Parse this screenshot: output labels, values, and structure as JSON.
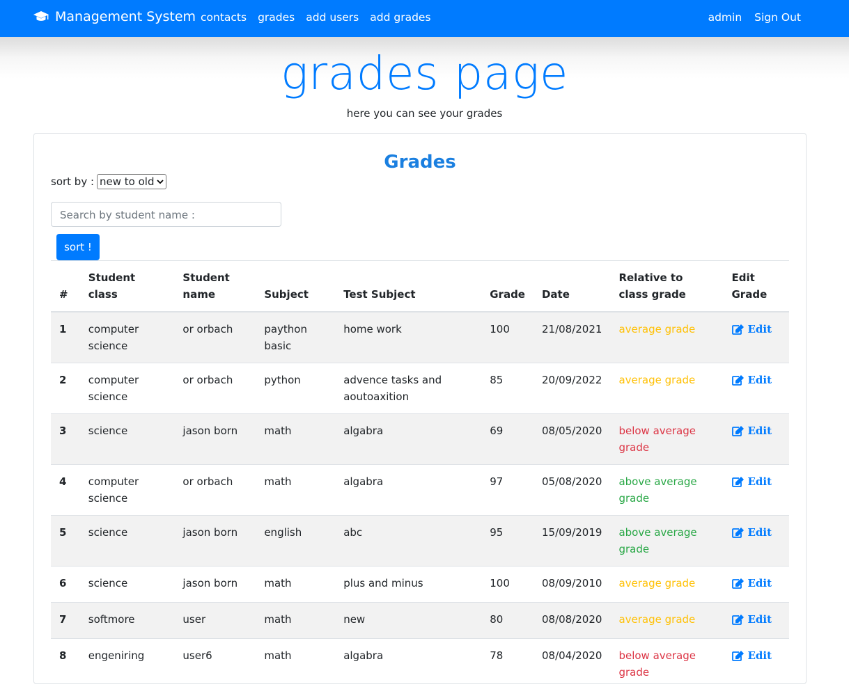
{
  "nav": {
    "brand": "Management System",
    "links": [
      "contacts",
      "grades",
      "add users",
      "add grades"
    ],
    "user": "admin",
    "signout": "Sign Out"
  },
  "hero": {
    "title": "grades page",
    "subtitle": "here you can see your grades"
  },
  "card": {
    "title": "Grades",
    "sort_label": "sort by :",
    "sort_selected": "new to old",
    "search_placeholder": "Search by student name :",
    "sort_button": "sort !"
  },
  "table": {
    "headers": [
      "#",
      "Student class",
      "Student name",
      "Subject",
      "Test Subject",
      "Grade",
      "Date",
      "Relative to class grade",
      "Edit Grade"
    ],
    "edit_label": "Edit",
    "rows": [
      {
        "n": "1",
        "cls": "computer science",
        "name": "or orbach",
        "subject": "paython basic",
        "test": "home work",
        "grade": "100",
        "date": "21/08/2021",
        "rel": "average grade",
        "rel_type": "avg"
      },
      {
        "n": "2",
        "cls": "computer science",
        "name": "or orbach",
        "subject": "python",
        "test": "advence tasks and aoutoaxition",
        "grade": "85",
        "date": "20/09/2022",
        "rel": "average grade",
        "rel_type": "avg"
      },
      {
        "n": "3",
        "cls": "science",
        "name": "jason born",
        "subject": "math",
        "test": "algabra",
        "grade": "69",
        "date": "08/05/2020",
        "rel": "below average grade",
        "rel_type": "below"
      },
      {
        "n": "4",
        "cls": "computer science",
        "name": "or orbach",
        "subject": "math",
        "test": "algabra",
        "grade": "97",
        "date": "05/08/2020",
        "rel": "above average grade",
        "rel_type": "above"
      },
      {
        "n": "5",
        "cls": "science",
        "name": "jason born",
        "subject": "english",
        "test": "abc",
        "grade": "95",
        "date": "15/09/2019",
        "rel": "above average grade",
        "rel_type": "above"
      },
      {
        "n": "6",
        "cls": "science",
        "name": "jason born",
        "subject": "math",
        "test": "plus and minus",
        "grade": "100",
        "date": "08/09/2010",
        "rel": "average grade",
        "rel_type": "avg"
      },
      {
        "n": "7",
        "cls": "softmore",
        "name": "user",
        "subject": "math",
        "test": "new",
        "grade": "80",
        "date": "08/08/2020",
        "rel": "average grade",
        "rel_type": "avg"
      },
      {
        "n": "8",
        "cls": "engeniring",
        "name": "user6",
        "subject": "math",
        "test": "algabra",
        "grade": "78",
        "date": "08/04/2020",
        "rel": "below average grade",
        "rel_type": "below"
      }
    ]
  },
  "colors": {
    "primary": "#007bff",
    "average": "#ffc107",
    "below": "#dc3545",
    "above": "#28a745"
  }
}
